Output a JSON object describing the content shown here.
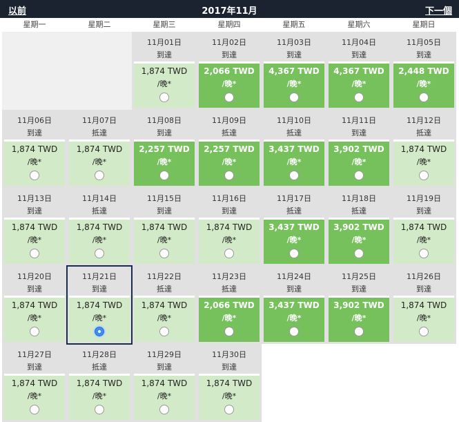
{
  "header": {
    "prev_label": "以前",
    "title": "2017年11月",
    "next_label": "下一個"
  },
  "weekdays": [
    "星期一",
    "星期二",
    "星期三",
    "星期四",
    "星期五",
    "星期六",
    "星期日"
  ],
  "unit_label": "/晚*",
  "colors": {
    "header_bg": "#1b2330",
    "price_light": "#d2eac7",
    "price_dark": "#77c15d",
    "selected_border": "#1c2b4a",
    "radio_checked": "#3b8ef5"
  },
  "days": [
    {
      "date": "11月01日",
      "status": "到達",
      "price": "1,874 TWD",
      "highlight": false,
      "selected": false
    },
    {
      "date": "11月02日",
      "status": "到達",
      "price": "2,066 TWD",
      "highlight": true,
      "selected": false
    },
    {
      "date": "11月03日",
      "status": "到達",
      "price": "4,367 TWD",
      "highlight": true,
      "selected": false
    },
    {
      "date": "11月04日",
      "status": "到達",
      "price": "4,367 TWD",
      "highlight": true,
      "selected": false
    },
    {
      "date": "11月05日",
      "status": "到達",
      "price": "2,448 TWD",
      "highlight": true,
      "selected": false
    },
    {
      "date": "11月06日",
      "status": "到達",
      "price": "1,874 TWD",
      "highlight": false,
      "selected": false
    },
    {
      "date": "11月07日",
      "status": "抵達",
      "price": "1,874 TWD",
      "highlight": false,
      "selected": false
    },
    {
      "date": "11月08日",
      "status": "到達",
      "price": "2,257 TWD",
      "highlight": true,
      "selected": false
    },
    {
      "date": "11月09日",
      "status": "抵達",
      "price": "2,257 TWD",
      "highlight": true,
      "selected": false
    },
    {
      "date": "11月10日",
      "status": "抵達",
      "price": "3,437 TWD",
      "highlight": true,
      "selected": false
    },
    {
      "date": "11月11日",
      "status": "到達",
      "price": "3,902 TWD",
      "highlight": true,
      "selected": false
    },
    {
      "date": "11月12日",
      "status": "抵達",
      "price": "1,874 TWD",
      "highlight": false,
      "selected": false
    },
    {
      "date": "11月13日",
      "status": "到達",
      "price": "1,874 TWD",
      "highlight": false,
      "selected": false
    },
    {
      "date": "11月14日",
      "status": "抵達",
      "price": "1,874 TWD",
      "highlight": false,
      "selected": false
    },
    {
      "date": "11月15日",
      "status": "到達",
      "price": "1,874 TWD",
      "highlight": false,
      "selected": false
    },
    {
      "date": "11月16日",
      "status": "到達",
      "price": "1,874 TWD",
      "highlight": false,
      "selected": false
    },
    {
      "date": "11月17日",
      "status": "抵達",
      "price": "3,437 TWD",
      "highlight": true,
      "selected": false
    },
    {
      "date": "11月18日",
      "status": "抵達",
      "price": "3,902 TWD",
      "highlight": true,
      "selected": false
    },
    {
      "date": "11月19日",
      "status": "到達",
      "price": "1,874 TWD",
      "highlight": false,
      "selected": false
    },
    {
      "date": "11月20日",
      "status": "到達",
      "price": "1,874 TWD",
      "highlight": false,
      "selected": false
    },
    {
      "date": "11月21日",
      "status": "到達",
      "price": "1,874 TWD",
      "highlight": false,
      "selected": true
    },
    {
      "date": "11月22日",
      "status": "抵達",
      "price": "1,874 TWD",
      "highlight": false,
      "selected": false
    },
    {
      "date": "11月23日",
      "status": "抵達",
      "price": "2,066 TWD",
      "highlight": true,
      "selected": false
    },
    {
      "date": "11月24日",
      "status": "到達",
      "price": "3,437 TWD",
      "highlight": true,
      "selected": false
    },
    {
      "date": "11月25日",
      "status": "到達",
      "price": "3,902 TWD",
      "highlight": true,
      "selected": false
    },
    {
      "date": "11月26日",
      "status": "到達",
      "price": "1,874 TWD",
      "highlight": false,
      "selected": false
    },
    {
      "date": "11月27日",
      "status": "到達",
      "price": "1,874 TWD",
      "highlight": false,
      "selected": false
    },
    {
      "date": "11月28日",
      "status": "抵達",
      "price": "1,874 TWD",
      "highlight": false,
      "selected": false
    },
    {
      "date": "11月29日",
      "status": "到達",
      "price": "1,874 TWD",
      "highlight": false,
      "selected": false
    },
    {
      "date": "11月30日",
      "status": "到達",
      "price": "1,874 TWD",
      "highlight": false,
      "selected": false
    }
  ]
}
